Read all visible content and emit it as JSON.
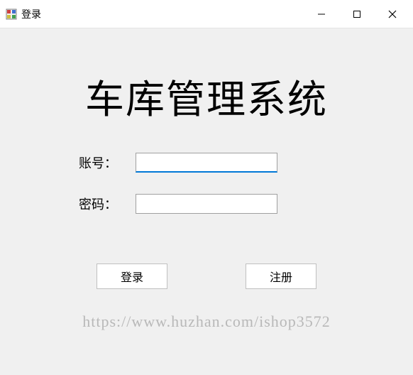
{
  "window": {
    "title": "登录"
  },
  "main": {
    "heading": "车库管理系统"
  },
  "form": {
    "username_label": "账号：",
    "username_value": "",
    "password_label": "密码：",
    "password_value": ""
  },
  "buttons": {
    "login": "登录",
    "register": "注册"
  },
  "watermark": "https://www.huzhan.com/ishop3572"
}
